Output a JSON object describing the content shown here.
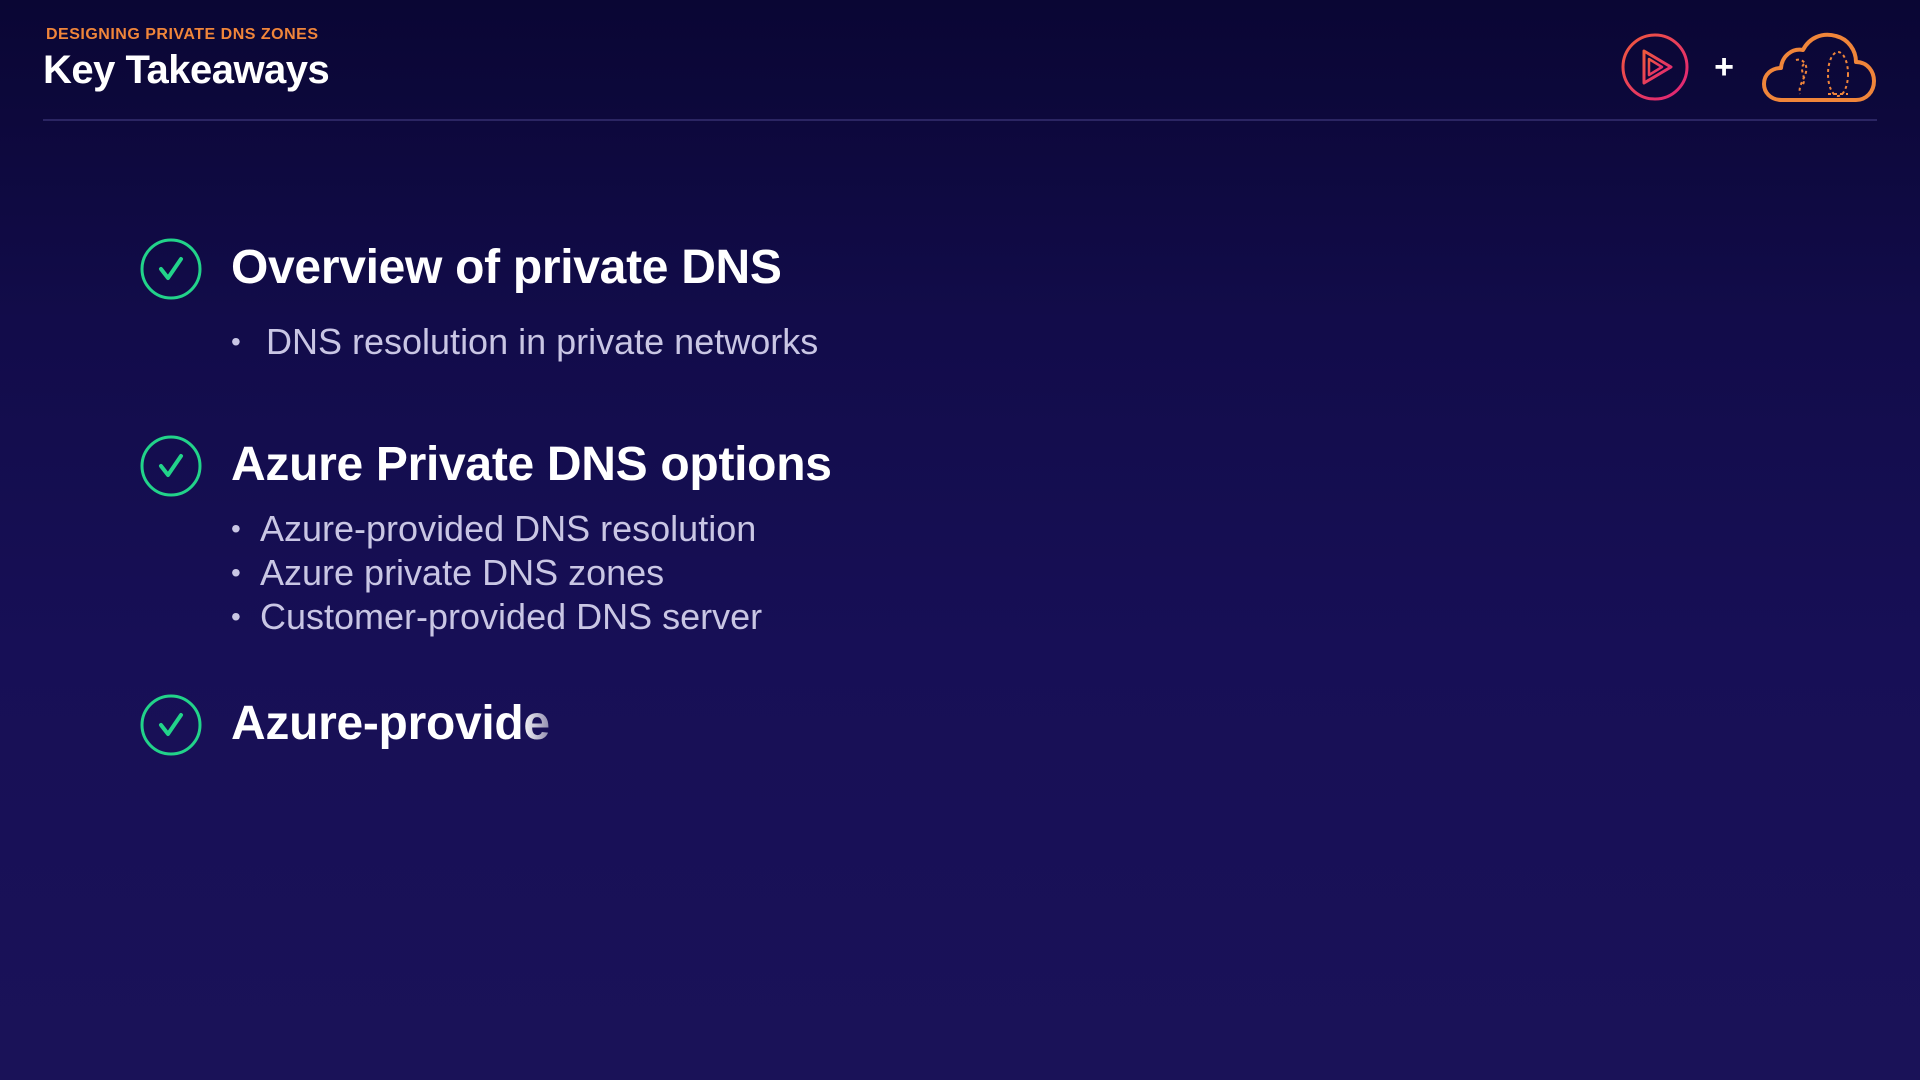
{
  "header": {
    "eyebrow": "DESIGNING PRIVATE DNS ZONES",
    "title": "Key Takeaways"
  },
  "logos": {
    "left_icon": "play-logo-icon",
    "plus": "+",
    "right_icon": "cloud-logo-icon"
  },
  "colors": {
    "background": "#140d4e",
    "accent_orange": "#f0853a",
    "check_green": "#22d38a",
    "text_white": "#ffffff",
    "text_muted": "#c9c6e4",
    "play_logo_gradient": [
      "#f05a3c",
      "#e0217a"
    ]
  },
  "takeaways": [
    {
      "heading": "Overview of private DNS",
      "bullets": [
        "DNS resolution in private networks"
      ]
    },
    {
      "heading": "Azure Private DNS options",
      "bullets": [
        "Azure-provided DNS resolution",
        "Azure private DNS zones",
        "Customer-provided DNS server"
      ]
    },
    {
      "heading": "Azure-provide",
      "bullets": []
    }
  ]
}
